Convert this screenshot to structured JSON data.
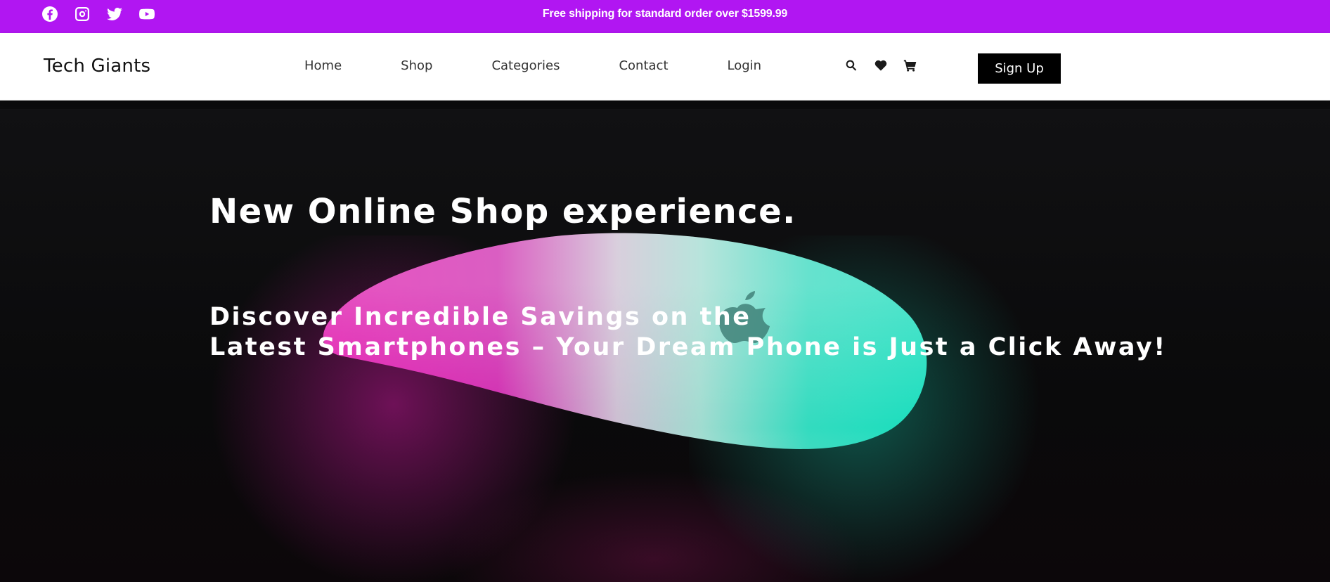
{
  "topbar": {
    "background": "#b116f2",
    "social_icons": [
      "facebook-icon",
      "instagram-icon",
      "twitter-icon",
      "youtube-icon"
    ],
    "shipping_text": "Free shipping for standard order over $1599.99"
  },
  "header": {
    "brand": "Tech Giants",
    "nav": [
      "Home",
      "Shop",
      "Categories",
      "Contact",
      "Login"
    ],
    "icons": [
      "search-icon",
      "heart-icon",
      "cart-icon"
    ],
    "signup_label": "Sign Up"
  },
  "hero": {
    "title": "New Online Shop experience.",
    "subtitle_line1": "Discover Incredible Savings on the",
    "subtitle_line2": "Latest Smartphones – Your Dream Phone is Just a Click Away!",
    "image": "glowing-magic-mouse-image",
    "colors": {
      "magenta": "#e81ab4",
      "teal": "#19e6c4"
    }
  }
}
